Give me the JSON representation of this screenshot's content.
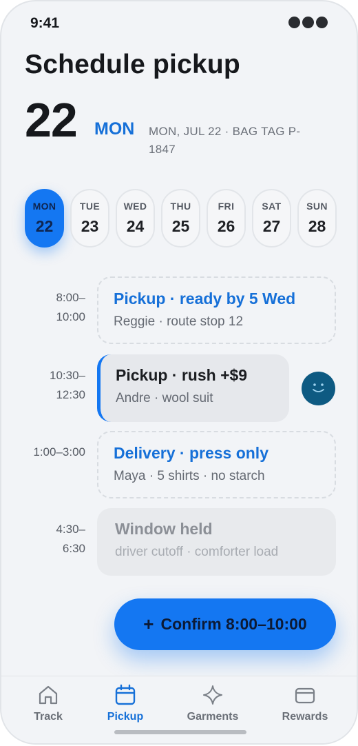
{
  "status": {
    "time": "9:41"
  },
  "header": {
    "title": "Schedule pickup",
    "day_number": "22",
    "weekday": "MON",
    "subtitle": "MON, JUL 22 · BAG TAG P-1847"
  },
  "days": [
    {
      "dow": "MON",
      "num": "22",
      "selected": true
    },
    {
      "dow": "TUE",
      "num": "23"
    },
    {
      "dow": "WED",
      "num": "24"
    },
    {
      "dow": "THU",
      "num": "25"
    },
    {
      "dow": "FRI",
      "num": "26"
    },
    {
      "dow": "SAT",
      "num": "27"
    },
    {
      "dow": "SUN",
      "num": "28"
    }
  ],
  "slots": [
    {
      "time_start": "8:00–",
      "time_end": "10:00",
      "title": "Pickup · ready by 5 Wed",
      "subtitle": "Reggie · route stop 12",
      "state": "open"
    },
    {
      "time_start": "10:30–",
      "time_end": "12:30",
      "title": "Pickup · rush +$9",
      "subtitle": "Andre · wool suit",
      "state": "booked"
    },
    {
      "time_start": "1:00–3:00",
      "time_end": "",
      "title": "Delivery · press only",
      "subtitle": "Maya · 5 shirts · no starch",
      "state": "open"
    },
    {
      "time_start": "4:30–",
      "time_end": "6:30",
      "title": "Window held",
      "subtitle": "driver cutoff · comforter load",
      "state": "held"
    }
  ],
  "cta": {
    "label": "Confirm 8:00–10:00",
    "icon": "plus-icon"
  },
  "tabs": [
    {
      "label": "Track",
      "icon": "home-icon"
    },
    {
      "label": "Pickup",
      "icon": "calendar-icon",
      "active": true
    },
    {
      "label": "Garments",
      "icon": "sparkle-icon"
    },
    {
      "label": "Rewards",
      "icon": "wallet-icon"
    }
  ],
  "colors": {
    "accent": "#1477f2",
    "accent_text": "#1670d8",
    "background": "#f2f4f7",
    "avatar": "#0e5a82"
  }
}
